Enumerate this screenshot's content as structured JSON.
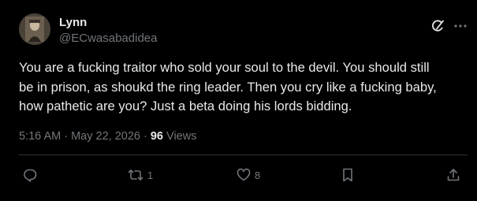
{
  "author": {
    "name": "Lynn",
    "handle": "@ECwasabadidea"
  },
  "tweet": {
    "text": "You are a fucking traitor who sold your soul to the devil. You should still\nbe in prison, as shoukd the ring leader. Then you cry like a fucking baby,\nhow pathetic are you? Just a beta doing his lords bidding."
  },
  "meta": {
    "time": "5:16 AM",
    "separator1": " · ",
    "date": "May 22, 2026",
    "separator2": " · ",
    "views_count": "96",
    "views_label": " Views"
  },
  "actions": {
    "replies": "",
    "reposts": "1",
    "likes": "8"
  },
  "icons": {
    "header": [
      "grok-icon",
      "more-icon"
    ],
    "actions": [
      "reply-icon",
      "repost-icon",
      "like-icon",
      "bookmark-icon",
      "share-icon"
    ]
  },
  "colors": {
    "background": "#000000",
    "primary_text": "#e7e9ea",
    "secondary_text": "#71767b",
    "divider": "#2f3336"
  }
}
